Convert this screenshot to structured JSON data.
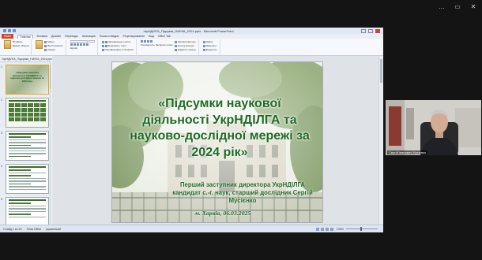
{
  "meeting": {
    "window_controls": [
      "…",
      "▭",
      "✕"
    ],
    "participant_name": "Сергій Іванович Мусієнко"
  },
  "powerpoint": {
    "window_title": "УкрНДІЛГА_Підсумкі_НАУКА_2024.pptx - Microsoft PowerPoint",
    "file_tab": "Файл",
    "tabs": [
      "Главная",
      "Вставка",
      "Дизайн",
      "Переходы",
      "Анимация",
      "Показ слайдов",
      "Рецензирование",
      "Вид",
      "Office Tab"
    ],
    "ribbon_groups": [
      {
        "name": "clipboard",
        "items": [
          "Вставить",
          "Буфер обмена"
        ]
      },
      {
        "name": "slides",
        "items": [
          "Макет",
          "Восстановить",
          "Раздел"
        ]
      },
      {
        "name": "font",
        "items": [
          "Шрифт"
        ]
      },
      {
        "name": "paragraph",
        "items": [
          "Направление текста",
          "Выровнять текст",
          "Преобразовать в SmartArt"
        ]
      },
      {
        "name": "drawing",
        "items": [
          "Упорядочить",
          "Экспресс-стили",
          "Заливка фигуры",
          "Контур фигуры",
          "Эффекты фигур"
        ]
      },
      {
        "name": "editing",
        "items": [
          "Найти",
          "Заменить",
          "Выделить"
        ]
      }
    ],
    "doc_tab": "УкрНДІЛГА_Підсумки_НАУКА_2024.pptx",
    "outline_tab": "Структура",
    "slide_numbers": [
      "1",
      "2",
      "3",
      "4",
      "5"
    ],
    "thumb1_text": "«Підсумки наукової діяльності УкрНДІЛГА та науково-дослідної мережі за 2024 рік»",
    "status": {
      "slide_info": "Слайд 1 из 25",
      "theme": "Тема Office",
      "language": "украинский",
      "zoom": "135%"
    }
  },
  "slide": {
    "title": "«Підсумки наукової діяльності УкрНДІЛГА та науково-дослідної мережі за 2024 рік»",
    "subtitle_line1": "Перший заступник директора УкрНДІЛГА",
    "subtitle_line2": "кандидат с.-г. наук, старший дослідник Сергій Мусієнко",
    "footer": "м. Харків, 06.03.2025"
  }
}
